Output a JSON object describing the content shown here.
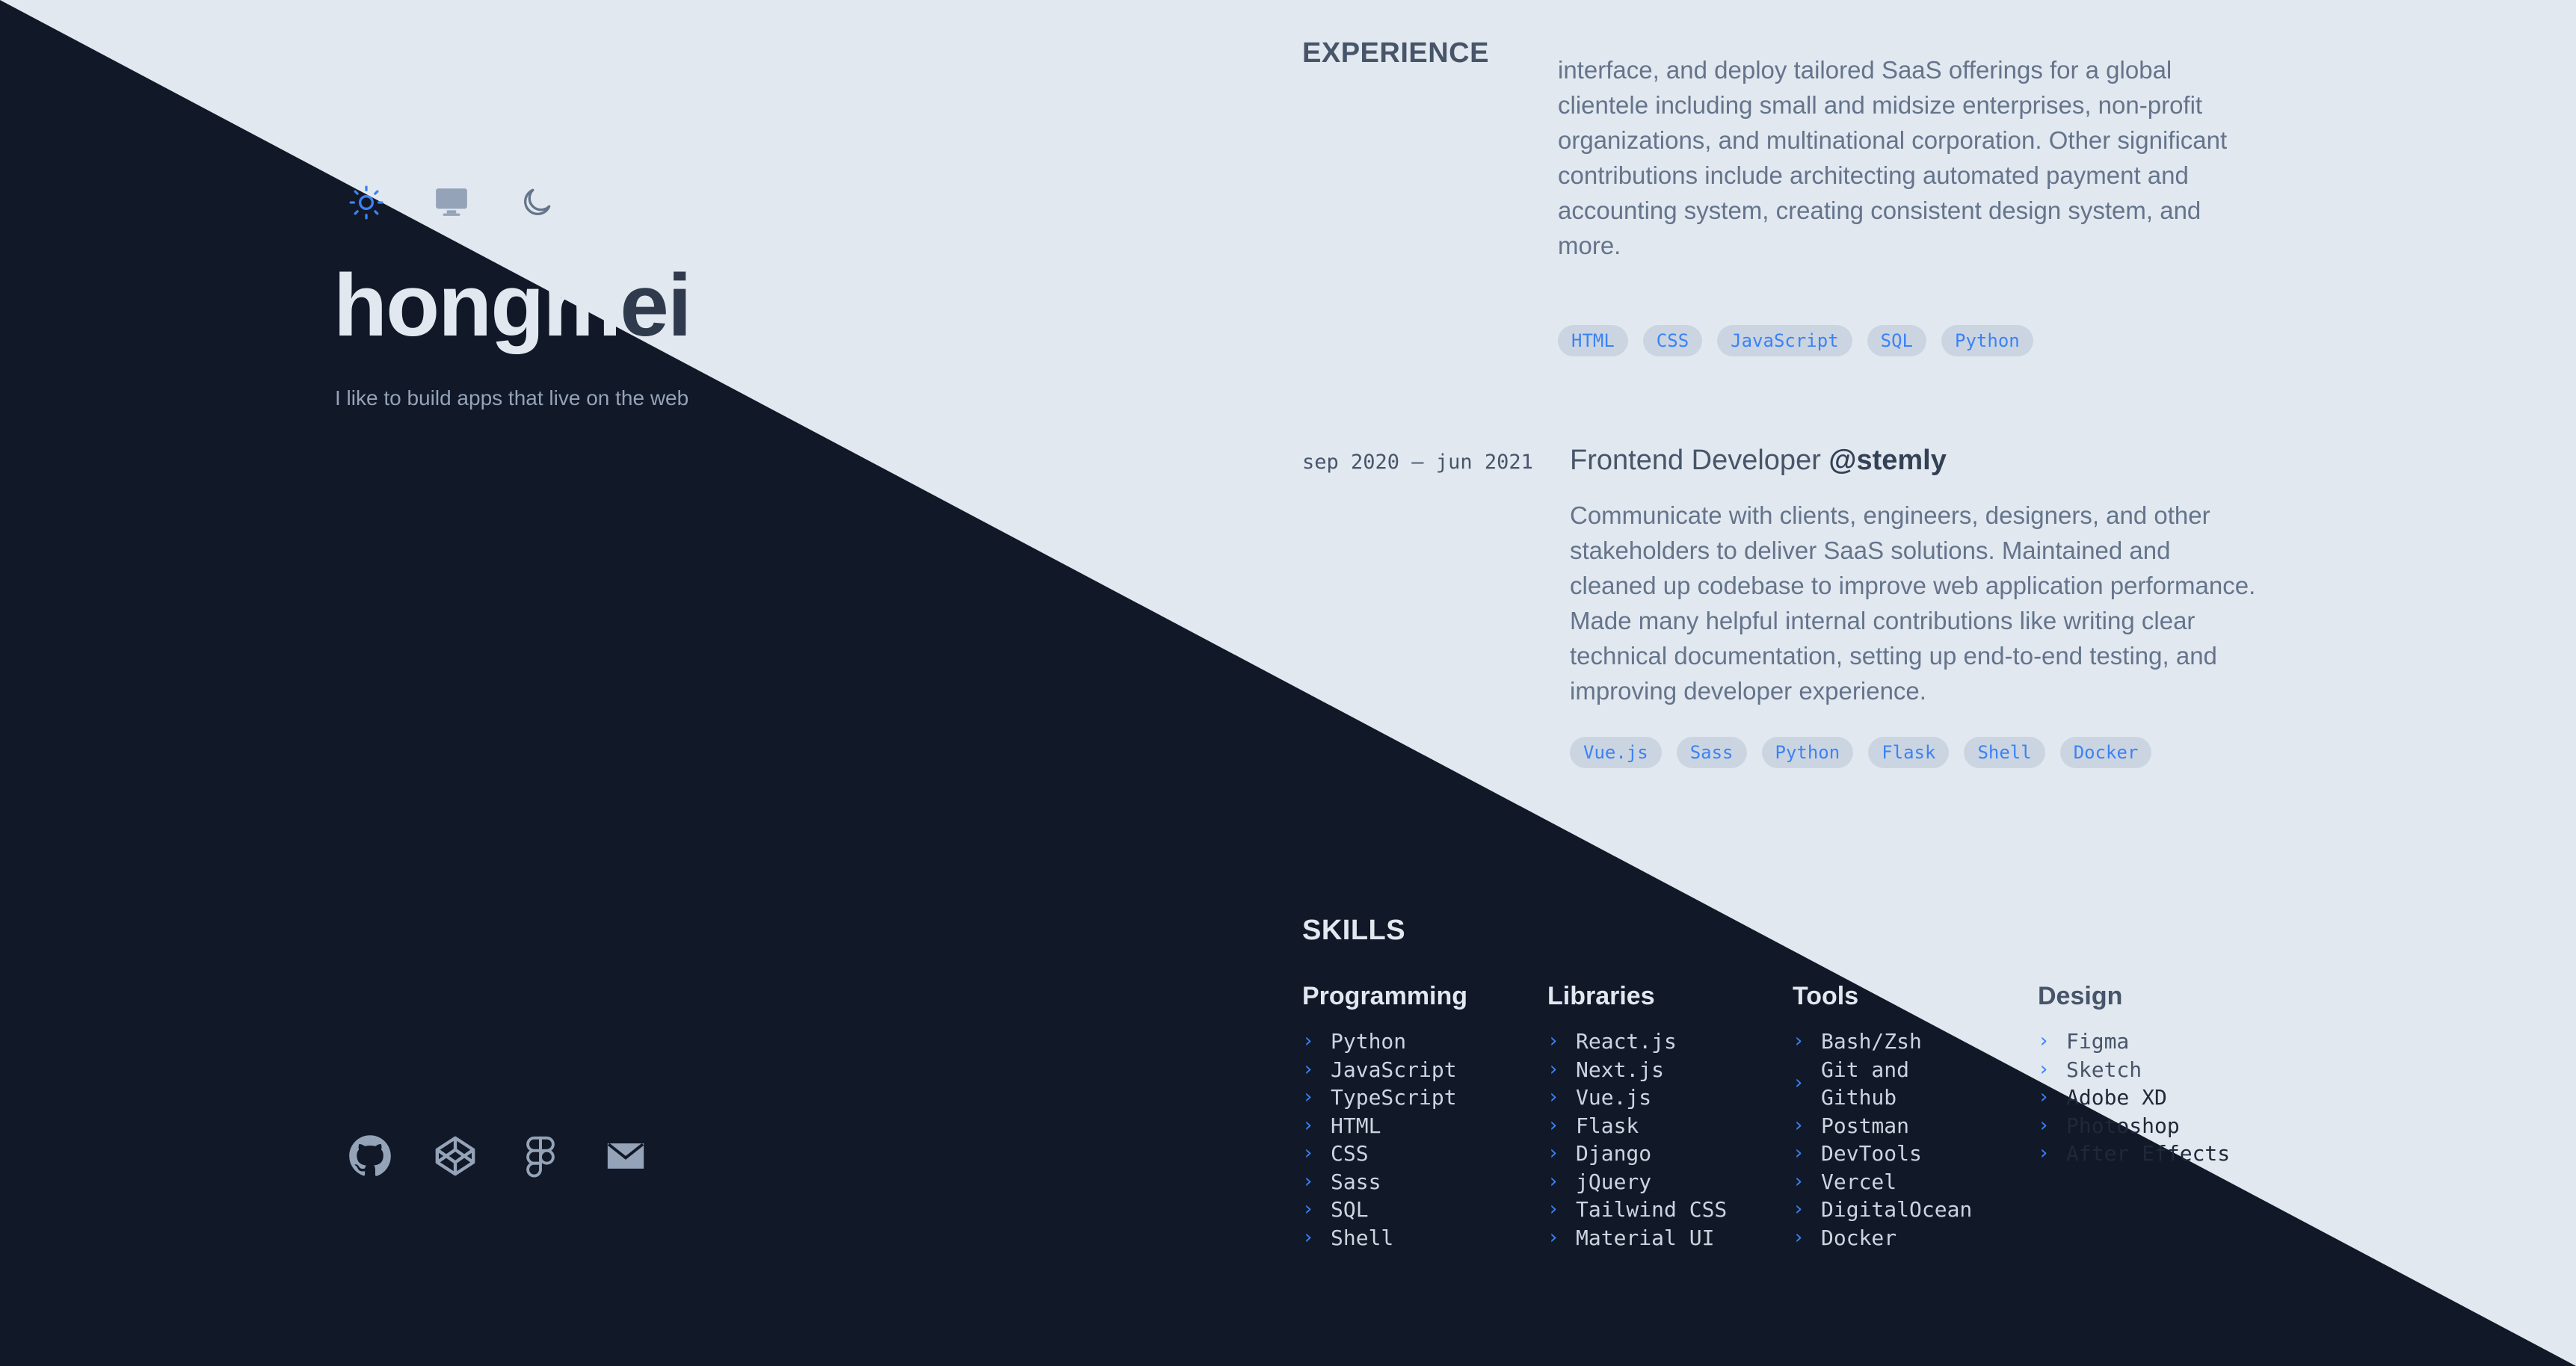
{
  "profile": {
    "name_part1": "hongm",
    "name_part2": "ei",
    "tagline": "I like to build apps that live on the web"
  },
  "theme_toggle": [
    {
      "icon": "sun-icon",
      "label": "Light"
    },
    {
      "icon": "monitor-icon",
      "label": "System"
    },
    {
      "icon": "moon-icon",
      "label": "Dark"
    }
  ],
  "socials": [
    {
      "icon": "github-icon"
    },
    {
      "icon": "codepen-icon"
    },
    {
      "icon": "figma-icon"
    },
    {
      "icon": "mail-icon"
    }
  ],
  "experience": {
    "title": "EXPERIENCE",
    "jobs": [
      {
        "date": "",
        "role": "",
        "company": "",
        "description": "interface, and deploy tailored SaaS offerings for a global clientele including small and midsize enterprises, non-profit organizations, and multinational corporation. Other significant contributions include architecting automated payment and accounting system, creating consistent design system, and more.",
        "tags": [
          "HTML",
          "CSS",
          "JavaScript",
          "SQL",
          "Python"
        ]
      },
      {
        "date": "sep 2020 – jun 2021",
        "role": "Frontend Developer",
        "company": "@stemly",
        "description": "Communicate with clients, engineers, designers, and other stakeholders to deliver SaaS solutions. Maintained and cleaned up codebase to improve web application performance. Made many helpful internal contributions like writing clear technical documentation, setting up end-to-end testing, and improving developer experience.",
        "tags": [
          "Vue.js",
          "Sass",
          "Python",
          "Flask",
          "Shell",
          "Docker"
        ]
      }
    ]
  },
  "skills": {
    "title": "SKILLS",
    "columns": [
      {
        "heading": "Programming",
        "items": [
          "Python",
          "JavaScript",
          "TypeScript",
          "HTML",
          "CSS",
          "Sass",
          "SQL",
          "Shell"
        ]
      },
      {
        "heading": "Libraries",
        "items": [
          "React.js",
          "Next.js",
          "Vue.js",
          "Flask",
          "Django",
          "jQuery",
          "Tailwind CSS",
          "Material UI"
        ]
      },
      {
        "heading": "Tools",
        "items": [
          "Bash/Zsh",
          "Git and Github",
          "Postman",
          "DevTools",
          "Vercel",
          "DigitalOcean",
          "Docker"
        ]
      },
      {
        "heading": "Design",
        "items": [
          "Figma",
          "Sketch",
          "Adobe XD",
          "Photoshop",
          "After Effects"
        ]
      }
    ]
  },
  "colors": {
    "dark_bg": "#111827",
    "light_bg": "#e2e8f0",
    "accent": "#3b82f6"
  }
}
